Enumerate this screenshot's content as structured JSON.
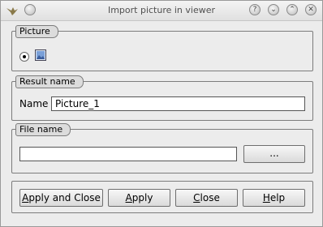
{
  "window": {
    "title": "Import picture in viewer"
  },
  "picture_group": {
    "title": "Picture",
    "radio_selected": true
  },
  "result_group": {
    "title": "Result name",
    "name_label": "Name",
    "name_value": "Picture_1"
  },
  "file_group": {
    "title": "File name",
    "path_value": "",
    "browse_label": "..."
  },
  "buttons": {
    "apply_close_pre": "",
    "apply_close_u": "A",
    "apply_close_post": "pply and Close",
    "apply_pre": "",
    "apply_u": "A",
    "apply_post": "pply",
    "close_pre": "",
    "close_u": "C",
    "close_post": "lose",
    "help_pre": "",
    "help_u": "H",
    "help_post": "elp"
  },
  "icons": [
    "bird-app-icon",
    "help-icon",
    "minimize-icon",
    "maximize-icon",
    "close-icon",
    "picture-icon"
  ]
}
